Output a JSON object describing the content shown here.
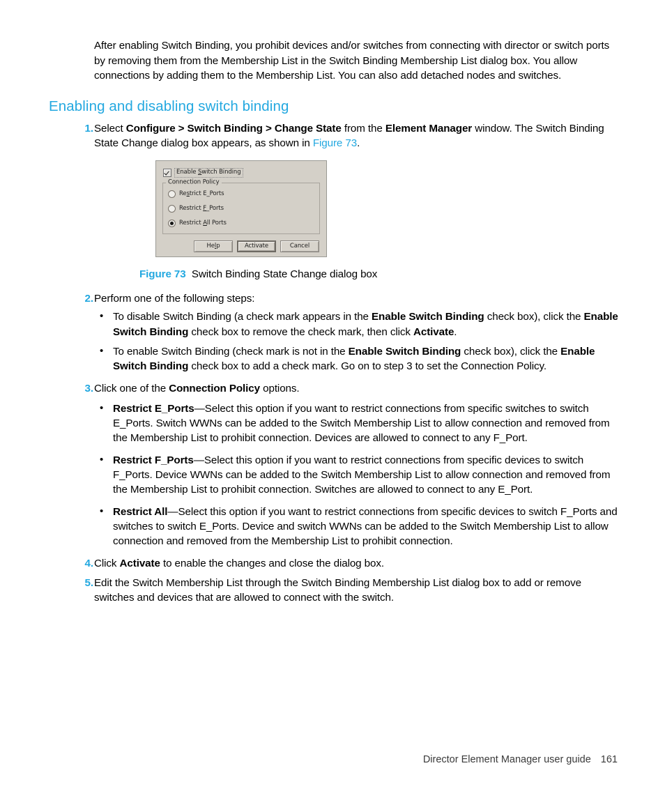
{
  "document": {
    "intro_paragraph": "After enabling Switch Binding, you prohibit devices and/or switches from connecting with director or switch ports by removing them from the Membership List in the Switch Binding Membership List dialog box. You allow connections by adding them to the Membership List. You can also add detached nodes and switches.",
    "section_heading": "Enabling and disabling switch binding",
    "accent_color": "#23a8e0",
    "text_color": "#000000"
  },
  "steps": {
    "step1": {
      "number": "1.",
      "part_a": "Select ",
      "bold_a": "Configure > Switch Binding > Change State",
      "part_b": " from the ",
      "bold_b": "Element Manager",
      "part_c": " window. The Switch Binding State Change dialog box appears, as shown in ",
      "link": "Figure 73",
      "part_d": "."
    },
    "step2": {
      "number": "2.",
      "text": "Perform one of the following steps:",
      "bullets": [
        {
          "part_a": "To disable Switch Binding (a check mark appears in the ",
          "bold_a": "Enable Switch Binding",
          "part_b": " check box), click the ",
          "bold_b": "Enable Switch Binding",
          "part_c": " check box to remove the check mark, then click ",
          "bold_c": "Activate",
          "part_d": "."
        },
        {
          "part_a": "To enable Switch Binding (check mark is not in the ",
          "bold_a": "Enable Switch Binding",
          "part_b": " check box), click the ",
          "bold_b": "Enable Switch Binding",
          "part_c": " check box to add a check mark. Go on to step 3 to set the Connection Policy.",
          "bold_c": "",
          "part_d": ""
        }
      ]
    },
    "step3": {
      "number": "3.",
      "part_a": "Click one of the ",
      "bold_a": "Connection Policy",
      "part_b": " options.",
      "bullets": [
        {
          "term": "Restrict E_Ports",
          "dash": "—",
          "body": "Select this option if you want to restrict connections from specific switches to switch E_Ports. Switch WWNs can be added to the Switch Membership List to allow connection and removed from the Membership List to prohibit connection. Devices are allowed to connect to any F_Port."
        },
        {
          "term": "Restrict F_Ports",
          "dash": "—",
          "body": "Select this option if you want to restrict connections from specific devices to switch F_Ports. Device WWNs can be added to the Switch Membership List to allow connection and removed from the Membership List to prohibit connection. Switches are allowed to connect to any E_Port."
        },
        {
          "term": "Restrict All",
          "dash": "—",
          "body": "Select this option if you want to restrict connections from specific devices to switch F_Ports and switches to switch E_Ports. Device and switch WWNs can be added to the Switch Membership List to allow connection and removed from the Membership List to prohibit connection."
        }
      ]
    },
    "step4": {
      "number": "4.",
      "part_a": "Click ",
      "bold_a": "Activate",
      "part_b": " to enable the changes and close the dialog box."
    },
    "step5": {
      "number": "5.",
      "text": "Edit the Switch Membership List through the Switch Binding Membership List dialog box to add or remove switches and devices that are allowed to connect with the switch."
    }
  },
  "figure": {
    "caption_label": "Figure 73",
    "caption_text": "Switch Binding State Change dialog box",
    "dialog": {
      "checkbox_label_pre": "Enable ",
      "checkbox_label_mnemonic": "S",
      "checkbox_label_post": "witch Binding",
      "checkbox_checked": true,
      "group_legend": "Connection Policy",
      "radios": [
        {
          "label_pre": "Re",
          "label_mnemonic": "s",
          "label_post": "trict E_Ports",
          "selected": false
        },
        {
          "label_pre": "Restrict ",
          "label_mnemonic": "F",
          "label_post": "_Ports",
          "selected": false
        },
        {
          "label_pre": "Restrict ",
          "label_mnemonic": "A",
          "label_post": "ll Ports",
          "selected": true
        }
      ],
      "buttons": [
        {
          "label_pre": "He",
          "label_mnemonic": "l",
          "label_post": "p",
          "default": false
        },
        {
          "label_pre": "Activate",
          "label_mnemonic": "",
          "label_post": "",
          "default": true
        },
        {
          "label_pre": "Cancel",
          "label_mnemonic": "",
          "label_post": "",
          "default": false
        }
      ]
    }
  },
  "footer": {
    "guide_title": "Director Element Manager user guide",
    "page_number": "161"
  }
}
